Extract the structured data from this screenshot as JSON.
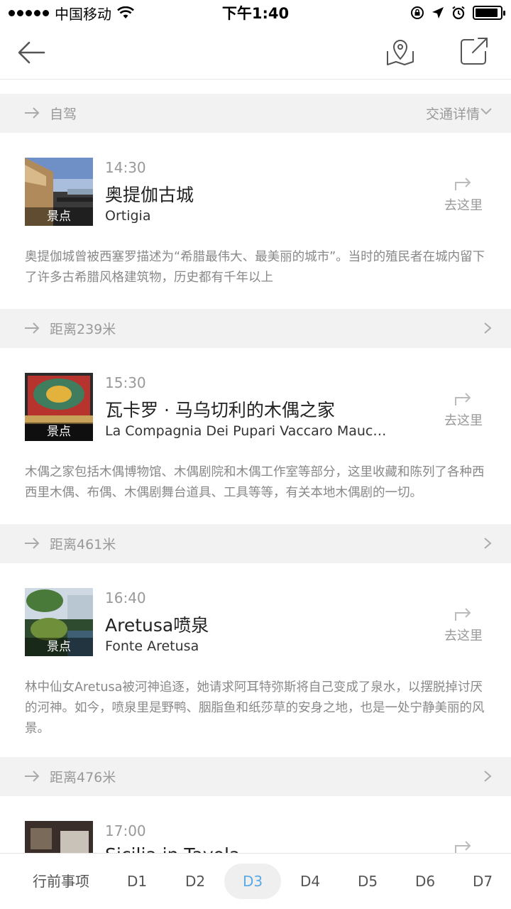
{
  "status_bar": {
    "carrier": "中国移动",
    "time": "下午1:40",
    "battery_level": 0.9
  },
  "nav": {
    "back_icon": "arrow-left-icon",
    "map_icon": "map-pin-icon",
    "share_icon": "share-icon"
  },
  "transits": [
    {
      "label": "自驾",
      "detail": "交通详情"
    },
    {
      "label": "距离239米"
    },
    {
      "label": "距离461米"
    },
    {
      "label": "距离476米"
    }
  ],
  "stops": [
    {
      "time": "14:30",
      "name": "奥提伽古城",
      "subtitle": "Ortigia",
      "tag": "景点",
      "goto": "去这里",
      "description": "奥提伽城曾被西塞罗描述为“希腊最伟大、最美丽的城市”。当时的殖民者在城内留下了许多古希腊风格建筑物，历史都有千年以上"
    },
    {
      "time": "15:30",
      "name": "瓦卡罗 · 马乌切利的木偶之家",
      "subtitle": "La Compagnia Dei Pupari Vaccaro Mauc…",
      "tag": "景点",
      "goto": "去这里",
      "description": "木偶之家包括木偶博物馆、木偶剧院和木偶工作室等部分，这里收藏和陈列了各种西西里木偶、布偶、木偶剧舞台道具、工具等等，有关本地木偶剧的一切。"
    },
    {
      "time": "16:40",
      "name": "Aretusa喷泉",
      "subtitle": "Fonte Aretusa",
      "tag": "景点",
      "goto": "去这里",
      "description": "林中仙女Aretusa被河神追逐，她请求阿耳特弥斯将自己变成了泉水，以摆脱掉讨厌的河神。如今，喷泉里是野鸭、胭脂鱼和纸莎草的安身之地，也是一处宁静美丽的风景。"
    },
    {
      "time": "17:00",
      "name": "Sicilia in Tavola"
    }
  ],
  "tabs": [
    "行前事项",
    "D1",
    "D2",
    "D3",
    "D4",
    "D5",
    "D6",
    "D7"
  ],
  "active_tab": "D3",
  "colors": {
    "accent": "#5aa9e6",
    "divider_bg": "#f2f2f2",
    "muted_text": "#999999"
  }
}
